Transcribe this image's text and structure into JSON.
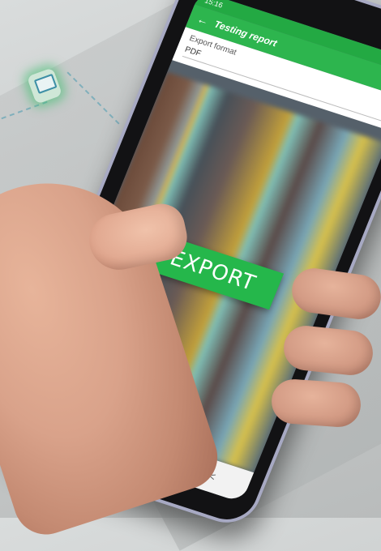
{
  "status": {
    "time": "15:16"
  },
  "app_bar": {
    "back_label": "←",
    "title": "Testing report"
  },
  "form": {
    "export_format_label": "Export format",
    "selected_value": "PDF",
    "dropdown_icon": "▾"
  },
  "actions": {
    "export_label": "EXPORT"
  },
  "nav": {
    "recent_apps": "|||",
    "home": "▢",
    "back": "<"
  },
  "colors": {
    "accent": "#2db54e",
    "status": "#23a943"
  }
}
